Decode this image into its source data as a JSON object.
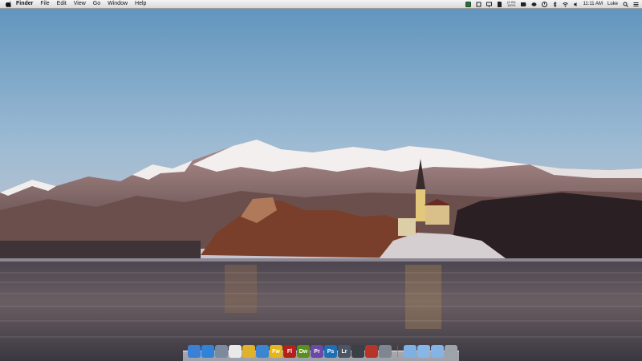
{
  "menubar": {
    "app_name": "Finder",
    "menus": [
      "File",
      "Edit",
      "View",
      "Go",
      "Window",
      "Help"
    ],
    "battery_top": "(1:02)",
    "battery_bottom": "100%",
    "clock": "11:11 AM",
    "user": "Luke"
  },
  "dock": {
    "apps": [
      {
        "name": "finder-icon",
        "label": "",
        "color": "#3b7fd6"
      },
      {
        "name": "safari-icon",
        "label": "",
        "color": "#2f84d8"
      },
      {
        "name": "preview-icon",
        "label": "",
        "color": "#7c8aa0"
      },
      {
        "name": "reminders-icon",
        "label": "",
        "color": "#e9e9e9"
      },
      {
        "name": "chrome-icon",
        "label": "",
        "color": "#e0b12a"
      },
      {
        "name": "app-store-icon",
        "label": "",
        "color": "#3a86d0"
      },
      {
        "name": "fireworks-icon",
        "label": "Fw",
        "color": "#e5b51a"
      },
      {
        "name": "flash-icon",
        "label": "Fl",
        "color": "#b5201b"
      },
      {
        "name": "dreamweaver-icon",
        "label": "Dw",
        "color": "#5a8f1f"
      },
      {
        "name": "premiere-icon",
        "label": "Pr",
        "color": "#6a4aa5"
      },
      {
        "name": "photoshop-icon",
        "label": "Ps",
        "color": "#1d6fb6"
      },
      {
        "name": "lightroom-icon",
        "label": "Lr",
        "color": "#4b5563"
      },
      {
        "name": "pencil-icon",
        "label": "",
        "color": "#3c3f46"
      },
      {
        "name": "reader-icon",
        "label": "",
        "color": "#b7342b"
      },
      {
        "name": "settings-icon",
        "label": "",
        "color": "#7e8790"
      }
    ],
    "stacks": [
      {
        "name": "applications-folder-icon",
        "color": "#7eb0e3"
      },
      {
        "name": "documents-folder-icon",
        "color": "#86b7e6"
      },
      {
        "name": "downloads-folder-icon",
        "color": "#83b4e4"
      },
      {
        "name": "trash-icon",
        "color": "#9da3aa"
      }
    ]
  }
}
